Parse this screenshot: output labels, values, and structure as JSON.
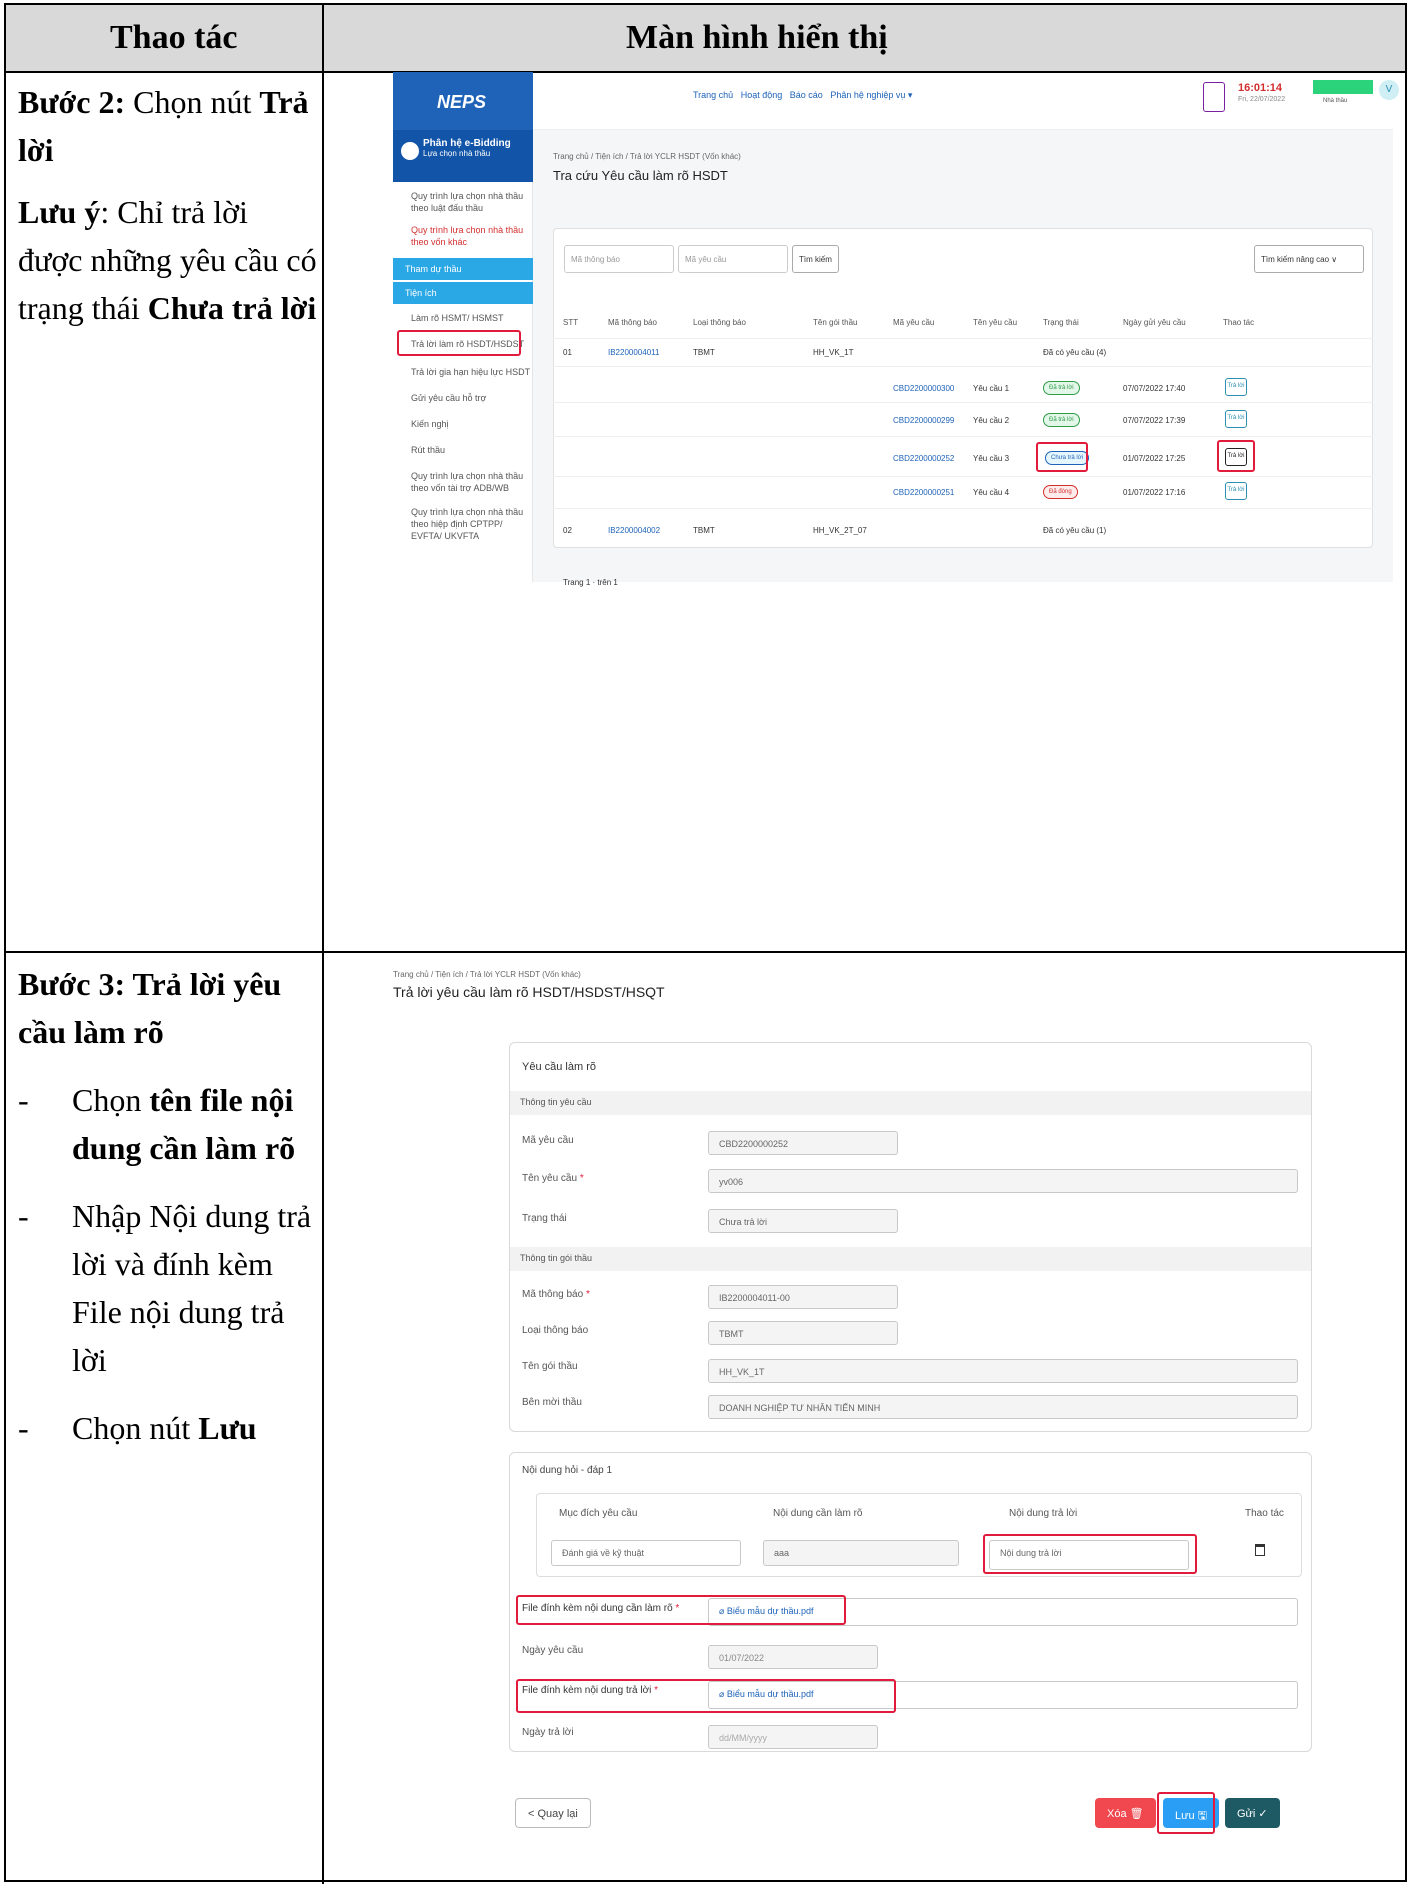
{
  "header": {
    "col1": "Thao tác",
    "col2": "Màn hình hiển thị"
  },
  "step2": {
    "title": "Bước 2:",
    "title_rest": "Chọn nút",
    "title_bold2": "Trả lời",
    "note_label": "Lưu ý",
    "note_text": ": Chỉ trả lời được những yêu cầu có trạng thái",
    "note_bold": "Chưa trả lời"
  },
  "step3": {
    "title": "Bước 3: Trả lời yêu cầu làm rõ",
    "b1_pre": "Chọn",
    "b1_bold": "tên file nội dung cần làm rõ",
    "b2": "Nhập Nội dung trả lời và đính kèm File nội dung trả lời",
    "b3_pre": "Chọn nút",
    "b3_bold": "Lưu"
  },
  "s1": {
    "logo": "NEPS",
    "nav": [
      "Trang chủ",
      "Hoạt động",
      "Báo cáo",
      "Phân hệ nghiệp vụ ▾"
    ],
    "time": "16:01:14",
    "date": "Fri, 22/07/2022",
    "user_initial": "V",
    "user_role": "Nhà thầu",
    "side_head": "Phân hệ e-Bidding",
    "side_sub": "Lựa chọn nhà thầu",
    "side": [
      "Quy trình lựa chọn nhà thầu theo luật đấu thầu",
      "Quy trình lựa chọn nhà thầu theo vốn khác",
      "Tham dự thầu",
      "Tiện ích",
      "Làm rõ HSMT/ HSMST",
      "Trả lời làm rõ HSDT/HSDST",
      "Trả lời gia hạn hiệu lực HSDT",
      "Gửi yêu cầu hỗ trợ",
      "Kiến nghị",
      "Rút thầu",
      "Quy trình lựa chọn nhà thầu theo vốn tài trợ ADB/WB",
      "Quy trình lựa chọn nhà thầu theo hiệp định CPTPP/ EVFTA/ UKVFTA"
    ],
    "breadcrumb": "Trang chủ / Tiện ích / Trả lời YCLR HSDT (Vốn khác)",
    "page_title": "Tra cứu Yêu cầu làm rõ HSDT",
    "ph_notice": "Mã thông báo",
    "ph_req": "Mã yêu cầu",
    "search_btn": "Tìm kiếm",
    "adv_btn": "Tìm kiếm nâng cao ∨",
    "cols": [
      "STT",
      "Mã thông báo",
      "Loại thông báo",
      "Tên gói thầu",
      "Mã yêu cầu",
      "Tên yêu cầu",
      "Trạng thái",
      "Ngày gửi yêu cầu",
      "Thao tác"
    ],
    "g1": {
      "stt": "01",
      "code": "IB2200004011",
      "type": "TBMT",
      "pkg": "HH_VK_1T",
      "status": "Đã có yêu cầu (4)"
    },
    "rows": [
      {
        "req": "CBD2200000300",
        "name": "Yêu cầu 1",
        "status": "Đã trả lời",
        "date": "07/07/2022 17:40",
        "act": "Trả lời"
      },
      {
        "req": "CBD2200000299",
        "name": "Yêu cầu 2",
        "status": "Đã trả lời",
        "date": "07/07/2022 17:39",
        "act": "Trả lời"
      },
      {
        "req": "CBD2200000252",
        "name": "Yêu cầu 3",
        "status": "Chưa trả lời",
        "date": "01/07/2022 17:25",
        "act": "Trả lời"
      },
      {
        "req": "CBD2200000251",
        "name": "Yêu cầu 4",
        "status": "Đã đóng",
        "date": "01/07/2022 17:16",
        "act": "Trả lời"
      }
    ],
    "g2": {
      "stt": "02",
      "code": "IB2200004002",
      "type": "TBMT",
      "pkg": "HH_VK_2T_07",
      "status": "Đã có yêu cầu (1)"
    },
    "pager": "Trang  1  ·  trên 1"
  },
  "s2": {
    "breadcrumb": "Trang chủ / Tiện ích / Trả lời YCLR HSDT (Vốn khác)",
    "title": "Trả lời yêu cầu làm rõ HSDT/HSDST/HSQT",
    "card_title": "Yêu cầu làm rõ",
    "sec1": "Thông tin yêu cầu",
    "f_req_label": "Mã yêu cầu",
    "f_req": "CBD2200000252",
    "f_name_label": "Tên yêu cầu",
    "f_name": "yv006",
    "f_status_label": "Trạng thái",
    "f_status": "Chưa trả lời",
    "sec2": "Thông tin gói thầu",
    "f_notice_label": "Mã thông báo",
    "f_notice": "IB2200004011-00",
    "f_type_label": "Loại thông báo",
    "f_type": "TBMT",
    "f_pkg_label": "Tên gói thầu",
    "f_pkg": "HH_VK_1T",
    "f_owner_label": "Bên mời thầu",
    "f_owner": "DOANH NGHIỆP TƯ NHÂN TIẾN MINH",
    "qa_title": "Nội dung hỏi - đáp 1",
    "qa_cols": [
      "Mục đích yêu cầu",
      "Nội dung cần làm rõ",
      "Nội dung trả lời",
      "Thao tác"
    ],
    "qa_purpose": "Đánh giá về kỹ thuật",
    "qa_content": "aaa",
    "qa_answer_ph": "Nội dung trả lời",
    "file_q_label": "File đính kèm nội dung cần làm rõ",
    "file_q": "Biểu mẫu dự thầu.pdf",
    "date_q_label": "Ngày yêu cầu",
    "date_q": "01/07/2022",
    "file_a_label": "File đính kèm nội dung trả lời",
    "file_a": "Biểu mẫu dự thầu.pdf",
    "date_a_label": "Ngày trả lời",
    "date_a_ph": "dd/MM/yyyy",
    "back": "< Quay lại",
    "delete": "Xóa 🗑",
    "save": "Lưu 🖫",
    "send": "Gửi ✓"
  }
}
